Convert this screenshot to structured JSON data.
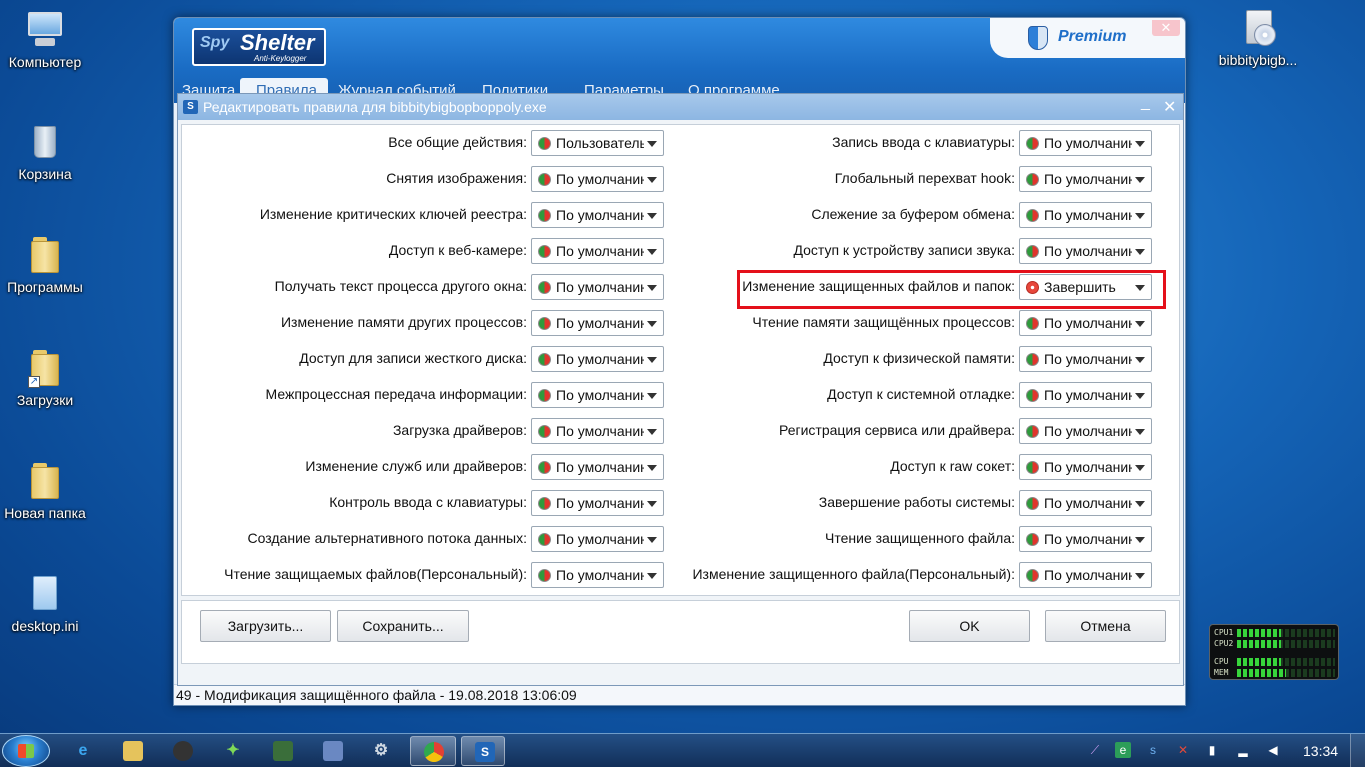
{
  "desktop": {
    "icons": [
      {
        "label": "Компьютер"
      },
      {
        "label": "Корзина"
      },
      {
        "label": "Программы"
      },
      {
        "label": "Загрузки"
      },
      {
        "label": "Новая папка"
      },
      {
        "label": "desktop.ini"
      },
      {
        "label": "bibbitybigb..."
      }
    ]
  },
  "main_window": {
    "logo_spy": "Spy",
    "logo_shelter": "Shelter",
    "logo_sub": "Anti-Keylogger",
    "premium": "Premium",
    "close_glyph": "✕",
    "menu": [
      "Защита",
      "Правила",
      "Журнал событий",
      "Политики",
      "Параметры",
      "О программе"
    ],
    "status": "49 - Модификация защищённого файла - 19.08.2018 13:06:09"
  },
  "dialog": {
    "icon_letter": "S",
    "title": "Редактировать правила для bibbitybigbopboppoly.exe",
    "minimize_glyph": "_",
    "close_glyph": "✕",
    "left_rules": [
      {
        "label": "Все общие действия:",
        "value": "Пользователь"
      },
      {
        "label": "Снятия изображения:",
        "value": "По умолчанию"
      },
      {
        "label": "Изменение критических ключей реестра:",
        "value": "По умолчанию"
      },
      {
        "label": "Доступ к веб-камере:",
        "value": "По умолчанию"
      },
      {
        "label": "Получать текст процесса другого окна:",
        "value": "По умолчанию"
      },
      {
        "label": "Изменение памяти других процессов:",
        "value": "По умолчанию"
      },
      {
        "label": "Доступ для записи жесткого диска:",
        "value": "По умолчанию"
      },
      {
        "label": "Межпроцессная передача информации:",
        "value": "По умолчанию"
      },
      {
        "label": "Загрузка драйверов:",
        "value": "По умолчанию"
      },
      {
        "label": "Изменение служб или драйверов:",
        "value": "По умолчанию"
      },
      {
        "label": "Контроль ввода с клавиатуры:",
        "value": "По умолчанию"
      },
      {
        "label": "Создание альтернативного потока данных:",
        "value": "По умолчанию"
      },
      {
        "label": "Чтение защищаемых файлов(Персональный):",
        "value": "По умолчанию"
      }
    ],
    "right_rules": [
      {
        "label": "Запись ввода с клавиатуры:",
        "value": "По умолчанию"
      },
      {
        "label": "Глобальный перехват hook:",
        "value": "По умолчанию"
      },
      {
        "label": "Слежение за буфером обмена:",
        "value": "По умолчанию"
      },
      {
        "label": "Доступ к устройству записи звука:",
        "value": "По умолчанию"
      },
      {
        "label": "Изменение защищенных файлов и папок:",
        "value": "Завершить"
      },
      {
        "label": "Чтение памяти защищённых процессов:",
        "value": "По умолчанию"
      },
      {
        "label": "Доступ к физической памяти:",
        "value": "По умолчанию"
      },
      {
        "label": "Доступ к системной отладке:",
        "value": "По умолчанию"
      },
      {
        "label": "Регистрация сервиса или драйвера:",
        "value": "По умолчанию"
      },
      {
        "label": "Доступ к raw сокет:",
        "value": "По умолчанию"
      },
      {
        "label": "Завершение работы системы:",
        "value": "По умолчанию"
      },
      {
        "label": "Чтение защищенного файла:",
        "value": "По умолчанию"
      },
      {
        "label": "Изменение защищенного файла(Персональный):",
        "value": "По умолчанию"
      }
    ],
    "highlighted_rule": "Изменение защищенных файлов и папок:",
    "buttons": {
      "load": "Загрузить...",
      "save": "Сохранить...",
      "ok": "OK",
      "cancel": "Отмена"
    }
  },
  "gadget": {
    "labels": [
      "CPU1",
      "CPU2",
      "CPU",
      "MEM"
    ],
    "levels": [
      0.45,
      0.45,
      0.45,
      0.5
    ]
  },
  "taskbar": {
    "clock": "13:34",
    "pinned": [
      "internet-explorer",
      "explorer",
      "media-tool",
      "app-green",
      "app-monitor",
      "app-settings",
      "app-gear",
      "chrome",
      "spyshelter"
    ]
  }
}
